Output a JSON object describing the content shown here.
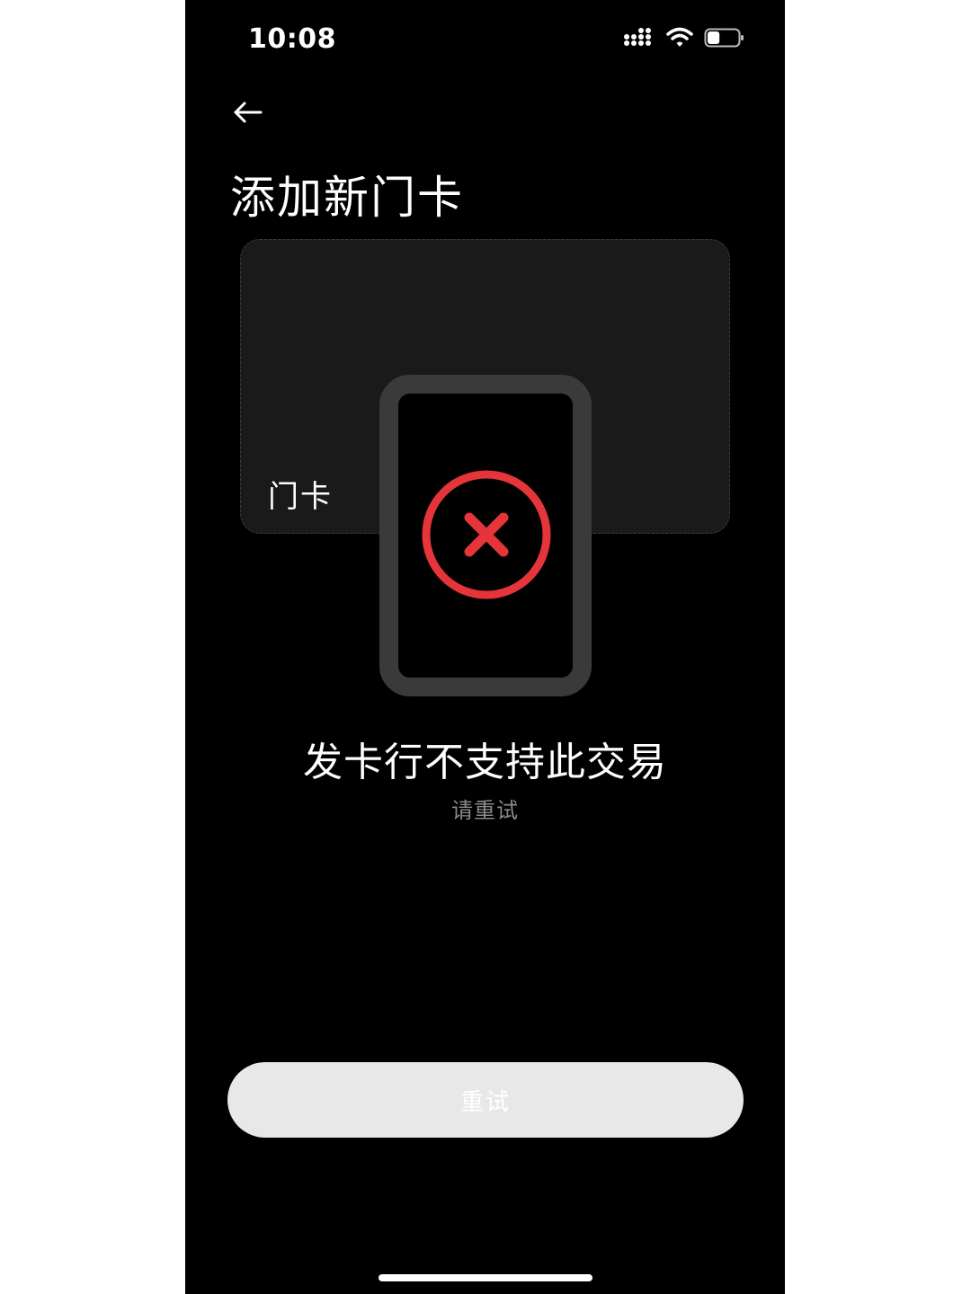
{
  "status_bar": {
    "time": "10:08",
    "signal_icon": "cellular-signal-icon",
    "wifi_icon": "wifi-icon",
    "battery_icon": "battery-icon",
    "battery_level": 0.4
  },
  "header": {
    "back_icon": "back-arrow-icon",
    "title": "添加新门卡"
  },
  "card": {
    "label": "门卡"
  },
  "illustration": {
    "icon": "error-x-icon",
    "accent_color": "#e5353a"
  },
  "message": {
    "title": "发卡行不支持此交易",
    "subtitle": "请重试"
  },
  "actions": {
    "retry_label": "重试"
  },
  "colors": {
    "background": "#000000",
    "card_background": "#1a1a1a",
    "button_background": "#e8e8e8",
    "error_red": "#e5353a"
  }
}
